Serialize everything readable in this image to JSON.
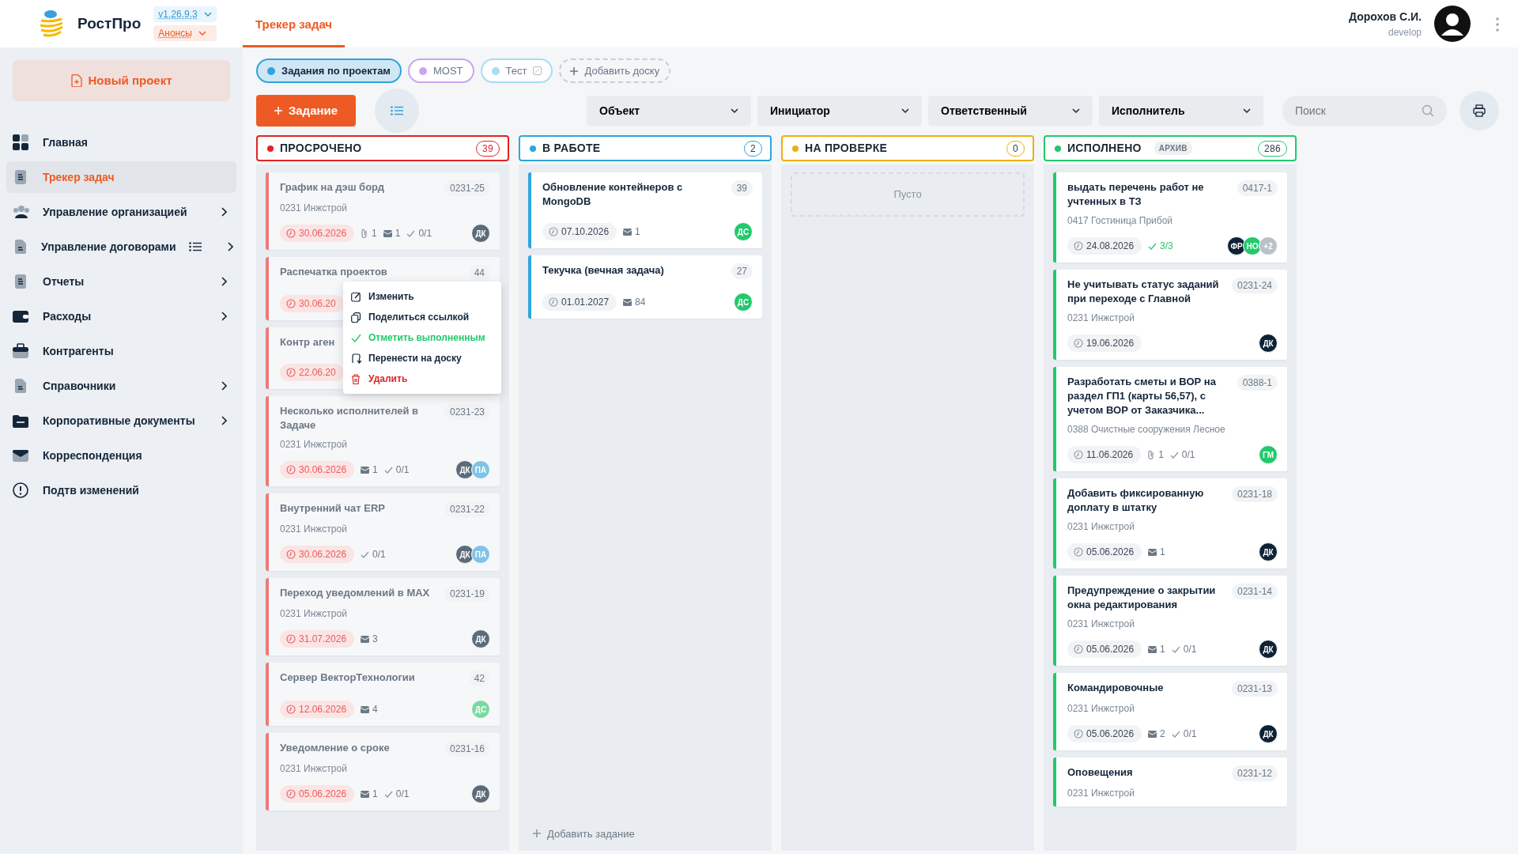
{
  "app": {
    "logo": "РостПро",
    "version": "v1.26.9.3",
    "announcements": "Анонсы"
  },
  "tabs": [
    {
      "label": "Трекер задач",
      "selected": true
    }
  ],
  "user": {
    "name": "Дорохов С.И.",
    "role": "develop"
  },
  "new_project": "Новый проект",
  "sidebar": {
    "items": [
      {
        "label": "Главная",
        "kind": "grid",
        "selected": false,
        "expandable": false
      },
      {
        "label": "Трекер задач",
        "kind": "doc",
        "selected": true,
        "expandable": false
      },
      {
        "label": "Управление организацией",
        "kind": "people",
        "selected": false,
        "expandable": true
      },
      {
        "label": "Управление договорами",
        "kind": "file",
        "selected": false,
        "expandable": true,
        "list_view": true
      },
      {
        "label": "Отчеты",
        "kind": "doc",
        "selected": false,
        "expandable": true
      },
      {
        "label": "Расходы",
        "kind": "wallet",
        "selected": false,
        "expandable": true
      },
      {
        "label": "Контрагенты",
        "kind": "briefcase",
        "selected": false,
        "expandable": false
      },
      {
        "label": "Справочники",
        "kind": "file",
        "selected": false,
        "expandable": true
      },
      {
        "label": "Корпоративные документы",
        "kind": "folder",
        "selected": false,
        "expandable": true
      },
      {
        "label": "Корреспонденция",
        "kind": "mail",
        "selected": false,
        "expandable": false
      },
      {
        "label": "Подтв изменений",
        "kind": "alert",
        "selected": false,
        "expandable": false
      }
    ]
  },
  "boards": [
    {
      "label": "Задания по проектам",
      "color": "#2fa3dc",
      "selected": true,
      "editable": false
    },
    {
      "label": "MOST",
      "color": "#c9a6ec",
      "selected": false,
      "editable": false
    },
    {
      "label": "Тест",
      "color": "#a8dcf2",
      "selected": false,
      "editable": true
    }
  ],
  "add_board": "Добавить доску",
  "add_task_button": "Задание",
  "filters": [
    "Объект",
    "Инициатор",
    "Ответственный",
    "Исполнитель"
  ],
  "search": {
    "placeholder": "Поиск"
  },
  "columns": [
    {
      "title": "ПРОСРОЧЕНО",
      "count": "39",
      "color": "#e02424",
      "kind": "overdue",
      "cards": [
        {
          "title": "График на дэш борд",
          "code": "0231-25",
          "project": "0231 Инжстрой",
          "date": "30.06.2026",
          "attachments": "1",
          "comments": "1",
          "checks": "0/1",
          "checks_done": false,
          "assignees": [
            {
              "initials": "ДК",
              "color": "#5b6b7a"
            }
          ]
        },
        {
          "title": "Распечатка проектов",
          "code": "44",
          "date": "30.06.20"
        },
        {
          "title": "Контр аген",
          "date": "22.06.20"
        },
        {
          "title": "Несколько исполнителей в Задаче",
          "code": "0231-23",
          "project": "0231 Инжстрой",
          "date": "30.06.2026",
          "comments": "1",
          "checks": "0/1",
          "checks_done": false,
          "assignees": [
            {
              "initials": "ДК",
              "color": "#5b6b7a"
            },
            {
              "initials": "ПА",
              "color": "#7fc4e6"
            }
          ]
        },
        {
          "title": "Внутренний чат ERP",
          "code": "0231-22",
          "project": "0231 Инжстрой",
          "date": "30.06.2026",
          "checks": "0/1",
          "checks_done": false,
          "assignees": [
            {
              "initials": "ДК",
              "color": "#5b6b7a"
            },
            {
              "initials": "ПА",
              "color": "#7fc4e6"
            }
          ]
        },
        {
          "title": "Переход уведомлений в MAX",
          "code": "0231-19",
          "project": "0231 Инжстрой",
          "date": "31.07.2026",
          "comments": "3",
          "assignees": [
            {
              "initials": "ДК",
              "color": "#5b6b7a"
            }
          ]
        },
        {
          "title": "Сервер ВекторТехнологии",
          "code": "42",
          "date": "12.06.2026",
          "comments": "4",
          "assignees": [
            {
              "initials": "ДС",
              "color": "#7ad9a0"
            }
          ]
        },
        {
          "title": "Уведомление о сроке",
          "code": "0231-16",
          "project": "0231 Инжстрой",
          "date": "05.06.2026",
          "comments": "1",
          "checks": "0/1",
          "checks_done": false,
          "assignees": [
            {
              "initials": "ДК",
              "color": "#5b6b7a"
            }
          ]
        }
      ]
    },
    {
      "title": "В РАБОТЕ",
      "count": "2",
      "color": "#2ea6dd",
      "kind": "normal",
      "add_task": "Добавить задание",
      "cards": [
        {
          "title": "Обновление контейнеров с MongoDB",
          "code": "39",
          "date": "07.10.2026",
          "comments": "1",
          "assignees": [
            {
              "initials": "ДС",
              "color": "#22c96b"
            }
          ]
        },
        {
          "title": "Текучка (вечная задача)",
          "code": "27",
          "date": "01.01.2027",
          "comments": "84",
          "assignees": [
            {
              "initials": "ДС",
              "color": "#22c96b"
            }
          ]
        }
      ]
    },
    {
      "title": "НА ПРОВЕРКЕ",
      "count": "0",
      "color": "#ecb012",
      "kind": "normal",
      "empty_text": "Пусто"
    },
    {
      "title": "ИСПОЛНЕНО",
      "count": "286",
      "color": "#22c96b",
      "kind": "normal",
      "archive": "АРХИВ",
      "cards": [
        {
          "title": "выдать перечень работ не учтенных в ТЗ",
          "code": "0417-1",
          "project": "0417 Гостиница Прибой",
          "date": "24.08.2026",
          "checks": "3/3",
          "checks_done": true,
          "assignees": [
            {
              "initials": "ФР",
              "color": "#0e2236"
            },
            {
              "initials": "НО",
              "color": "#22c96b"
            },
            {
              "initials": "+2",
              "color": "#b9c1c9"
            }
          ]
        },
        {
          "title": "Не учитывать статус заданий при переходе с Главной",
          "code": "0231-24",
          "project": "0231 Инжстрой",
          "date": "19.06.2026",
          "assignees": [
            {
              "initials": "ДК",
              "color": "#0e2236"
            }
          ]
        },
        {
          "title": "Разработать сметы и ВОР на раздел ГП1 (карты 56,57), с учетом ВОР от Заказчика...",
          "code": "0388-1",
          "project": "0388 Очистные сооружения Лесное",
          "date": "11.06.2026",
          "attachments": "1",
          "checks": "0/1",
          "checks_done": false,
          "assignees": [
            {
              "initials": "ГМ",
              "color": "#22c96b"
            }
          ]
        },
        {
          "title": "Добавить фиксированную доплату в штатку",
          "code": "0231-18",
          "project": "0231 Инжстрой",
          "date": "05.06.2026",
          "comments": "1",
          "assignees": [
            {
              "initials": "ДК",
              "color": "#0e2236"
            }
          ]
        },
        {
          "title": "Предупреждение о закрытии окна редактирования",
          "code": "0231-14",
          "project": "0231 Инжстрой",
          "date": "05.06.2026",
          "comments": "1",
          "checks": "0/1",
          "checks_done": false,
          "assignees": [
            {
              "initials": "ДК",
              "color": "#0e2236"
            }
          ]
        },
        {
          "title": "Командировочные",
          "code": "0231-13",
          "project": "0231 Инжстрой",
          "date": "05.06.2026",
          "comments": "2",
          "checks": "0/1",
          "checks_done": false,
          "assignees": [
            {
              "initials": "ДК",
              "color": "#0e2236"
            }
          ]
        },
        {
          "title": "Оповещения",
          "code": "0231-12",
          "project": "0231 Инжстрой"
        }
      ]
    }
  ],
  "context_menu": [
    {
      "label": "Изменить",
      "kind": "edit"
    },
    {
      "label": "Поделиться ссылкой",
      "kind": "share"
    },
    {
      "label": "Отметить выполненным",
      "kind": "complete"
    },
    {
      "label": "Перенести на доску",
      "kind": "move"
    },
    {
      "label": "Удалить",
      "kind": "delete"
    }
  ]
}
